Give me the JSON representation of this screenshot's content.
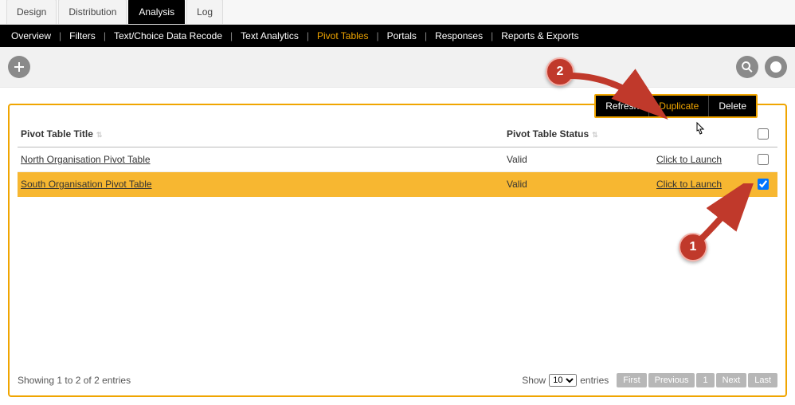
{
  "top_tabs": {
    "t0": "Design",
    "t1": "Distribution",
    "t2": "Analysis",
    "t3": "Log",
    "active_index": 2
  },
  "subnav": {
    "i0": "Overview",
    "i1": "Filters",
    "i2": "Text/Choice Data Recode",
    "i3": "Text Analytics",
    "i4": "Pivot Tables",
    "i5": "Portals",
    "i6": "Responses",
    "i7": "Reports & Exports",
    "active_index": 4
  },
  "actions": {
    "refresh": "Refresh",
    "duplicate": "Duplicate",
    "delete": "Delete"
  },
  "table": {
    "col_title": "Pivot Table Title",
    "col_status": "Pivot Table Status",
    "rows": [
      {
        "title": "North Organisation Pivot Table",
        "status": "Valid",
        "launch": "Click to Launch",
        "checked": false
      },
      {
        "title": "South Organisation Pivot Table",
        "status": "Valid",
        "launch": "Click to Launch",
        "checked": true
      }
    ]
  },
  "footer": {
    "showing": "Showing 1 to 2 of 2 entries",
    "show_label_pre": "Show",
    "show_label_post": "entries",
    "page_size": "10",
    "pager": {
      "first": "First",
      "prev": "Previous",
      "page": "1",
      "next": "Next",
      "last": "Last"
    }
  },
  "annotations": {
    "c1": "1",
    "c2": "2"
  }
}
